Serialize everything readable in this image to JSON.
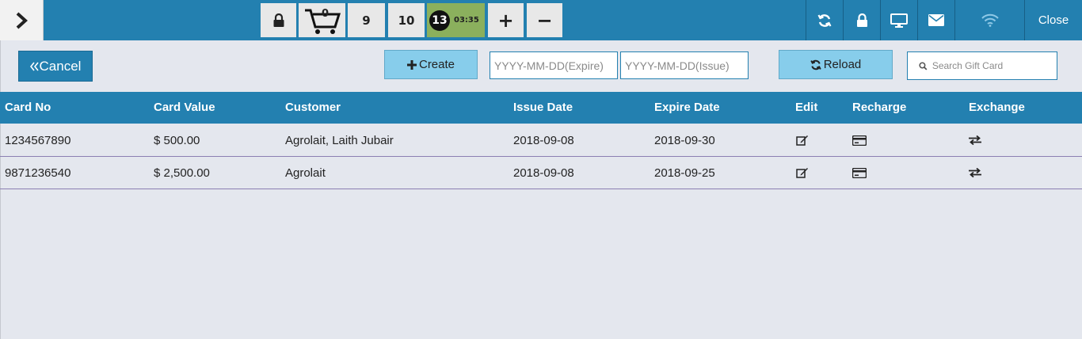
{
  "topbar": {
    "buttons": [
      {
        "name": "lock",
        "icon": "lock-icon"
      },
      {
        "name": "cart",
        "icon": "cart-icon",
        "count": "0"
      },
      {
        "name": "table-9",
        "label": "9"
      },
      {
        "name": "table-10",
        "label": "10"
      }
    ],
    "order": {
      "number": "13",
      "time": "03:35"
    },
    "add_label": "+",
    "remove_label": "−",
    "right_icons": [
      "refresh-icon",
      "lock-icon",
      "monitor-icon",
      "envelope-icon",
      "wifi-icon"
    ],
    "close_label": "Close"
  },
  "toolbar": {
    "cancel_label": "Cancel",
    "create_label": "Create",
    "expire_placeholder": "YYYY-MM-DD(Expire)",
    "issue_placeholder": "YYYY-MM-DD(Issue)",
    "reload_label": "Reload",
    "search_placeholder": "Search Gift Card"
  },
  "table": {
    "headers": {
      "card_no": "Card No",
      "card_value": "Card Value",
      "customer": "Customer",
      "issue_date": "Issue Date",
      "expire_date": "Expire Date",
      "edit": "Edit",
      "recharge": "Recharge",
      "exchange": "Exchange"
    },
    "rows": [
      {
        "card_no": "1234567890",
        "card_value": "$ 500.00",
        "customer": "Agrolait, Laith Jubair",
        "issue_date": "2018-09-08",
        "expire_date": "2018-09-30"
      },
      {
        "card_no": "9871236540",
        "card_value": "$ 2,500.00",
        "customer": "Agrolait",
        "issue_date": "2018-09-08",
        "expire_date": "2018-09-25"
      }
    ]
  },
  "colors": {
    "primary": "#2380b0",
    "light_button": "#87cdeb",
    "order_badge": "#8bb05d",
    "background": "#e4e7ee"
  }
}
